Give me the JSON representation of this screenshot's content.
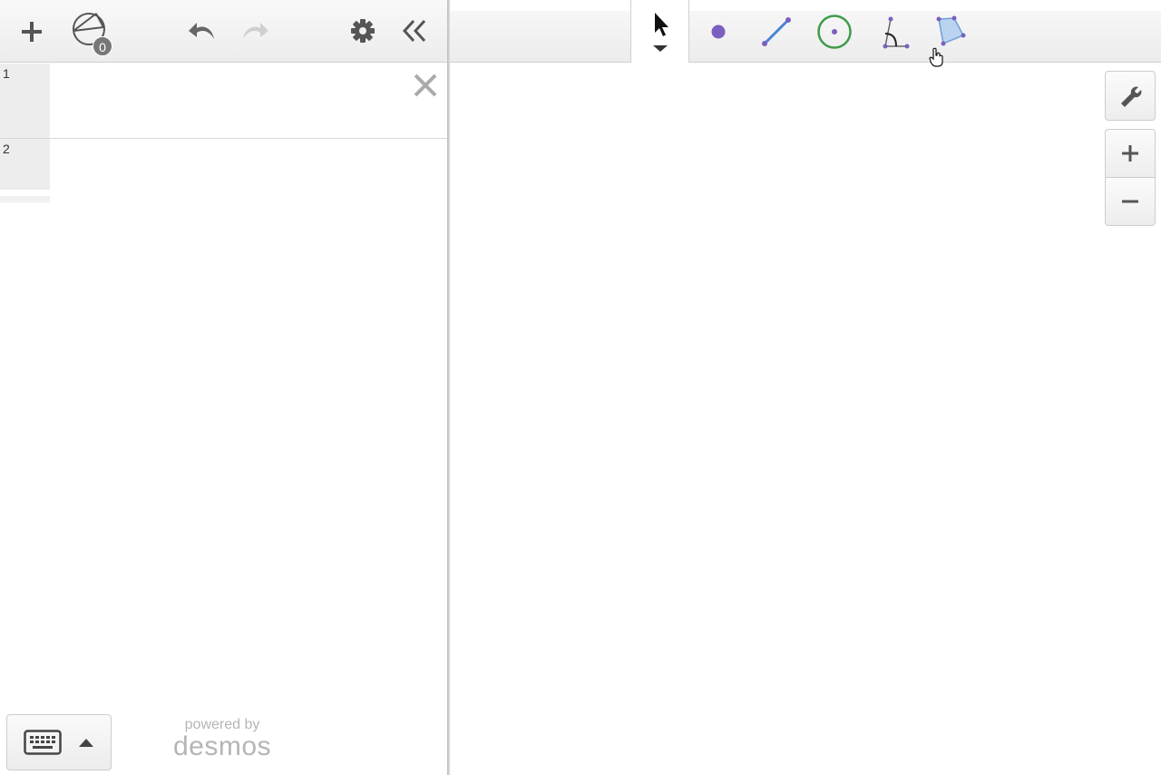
{
  "expression_panel": {
    "toolbar": {
      "add_icon": "plus-icon",
      "construction_icon": "construction-icon",
      "construction_count": "0",
      "undo_icon": "undo-icon",
      "redo_icon": "redo-icon",
      "settings_icon": "gear-icon",
      "collapse_icon": "double-chevron-left-icon"
    },
    "rows": [
      {
        "number": "1",
        "content": "",
        "delete_icon": "close-icon"
      },
      {
        "number": "2",
        "content": ""
      }
    ],
    "keyboard_toggle": {
      "icon": "keyboard-icon",
      "arrow": "caret-up-icon"
    },
    "branding": {
      "powered_by": "powered by",
      "logo": "desmos"
    }
  },
  "graph_area": {
    "tools": [
      {
        "name": "select",
        "icon": "arrow-cursor-icon",
        "active": true
      },
      {
        "name": "point",
        "icon": "point-icon"
      },
      {
        "name": "segment",
        "icon": "segment-icon"
      },
      {
        "name": "circle",
        "icon": "circle-icon"
      },
      {
        "name": "angle",
        "icon": "angle-icon"
      },
      {
        "name": "polygon",
        "icon": "polygon-icon",
        "hovered": true
      }
    ],
    "side_buttons": [
      "wrench-icon",
      "zoom-in-icon",
      "zoom-out-icon"
    ]
  },
  "colors": {
    "point": "#7b5fc0",
    "segment": "#4a83d6",
    "circle": "#3f9b4a",
    "polygon_fill": "#b9d3f0",
    "icon_gray": "#555555"
  }
}
